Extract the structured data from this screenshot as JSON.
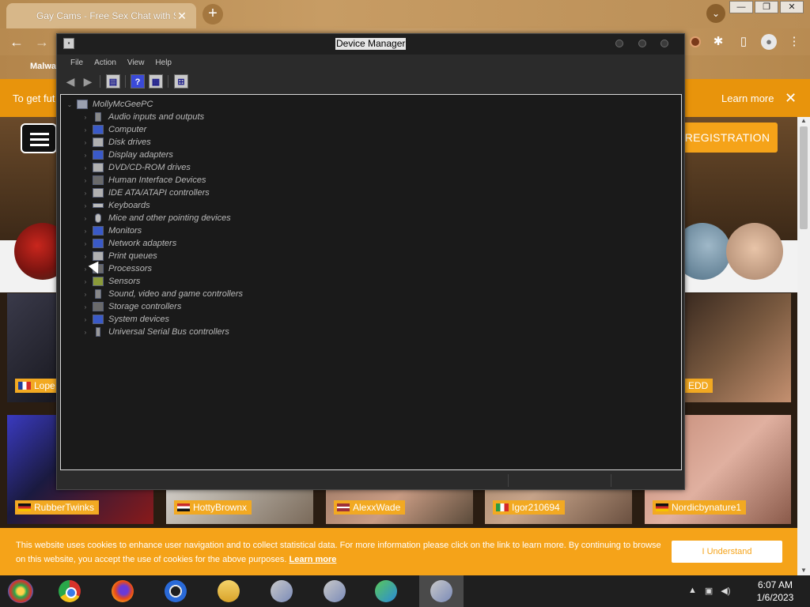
{
  "browser": {
    "tab_title": "Gay Cams - Free Sex Chat with S...",
    "tab_close": "✕",
    "new_tab": "+",
    "bookmark": "Malwa",
    "window_buttons": [
      "—",
      "❐",
      "✕"
    ]
  },
  "infobar": {
    "text": "To get fut",
    "learn_more": "Learn more",
    "close": "✕"
  },
  "site": {
    "register_label": "REGISTRATION",
    "cams": [
      {
        "name": "Lope",
        "flag": "fr"
      },
      {
        "name": "EDD",
        "flag": ""
      },
      {
        "name": "RubberTwinks",
        "flag": "de"
      },
      {
        "name": "HottyBrownx",
        "flag": "eg"
      },
      {
        "name": "AlexxWade",
        "flag": "lv"
      },
      {
        "name": "Igor210694",
        "flag": "it"
      },
      {
        "name": "Nordicbynature1",
        "flag": "de"
      }
    ],
    "cookie_text": "This website uses cookies to enhance user navigation and to collect statistical data. For more information please click on the link to learn more. By continuing to browse on this website, you accept the use of cookies for the above purposes.",
    "cookie_link": "Learn more",
    "cookie_button": "I Understand"
  },
  "device_manager": {
    "title": "Device Manager",
    "menus": [
      "File",
      "Action",
      "View",
      "Help"
    ],
    "root": "MollyMcGeePC",
    "categories": [
      "Audio inputs and outputs",
      "Computer",
      "Disk drives",
      "Display adapters",
      "DVD/CD-ROM drives",
      "Human Interface Devices",
      "IDE ATA/ATAPI controllers",
      "Keyboards",
      "Mice and other pointing devices",
      "Monitors",
      "Network adapters",
      "Print queues",
      "Processors",
      "Sensors",
      "Sound, video and game controllers",
      "Storage controllers",
      "System devices",
      "Universal Serial Bus controllers"
    ]
  },
  "taskbar": {
    "time": "6:07 AM",
    "date": "1/6/2023"
  }
}
